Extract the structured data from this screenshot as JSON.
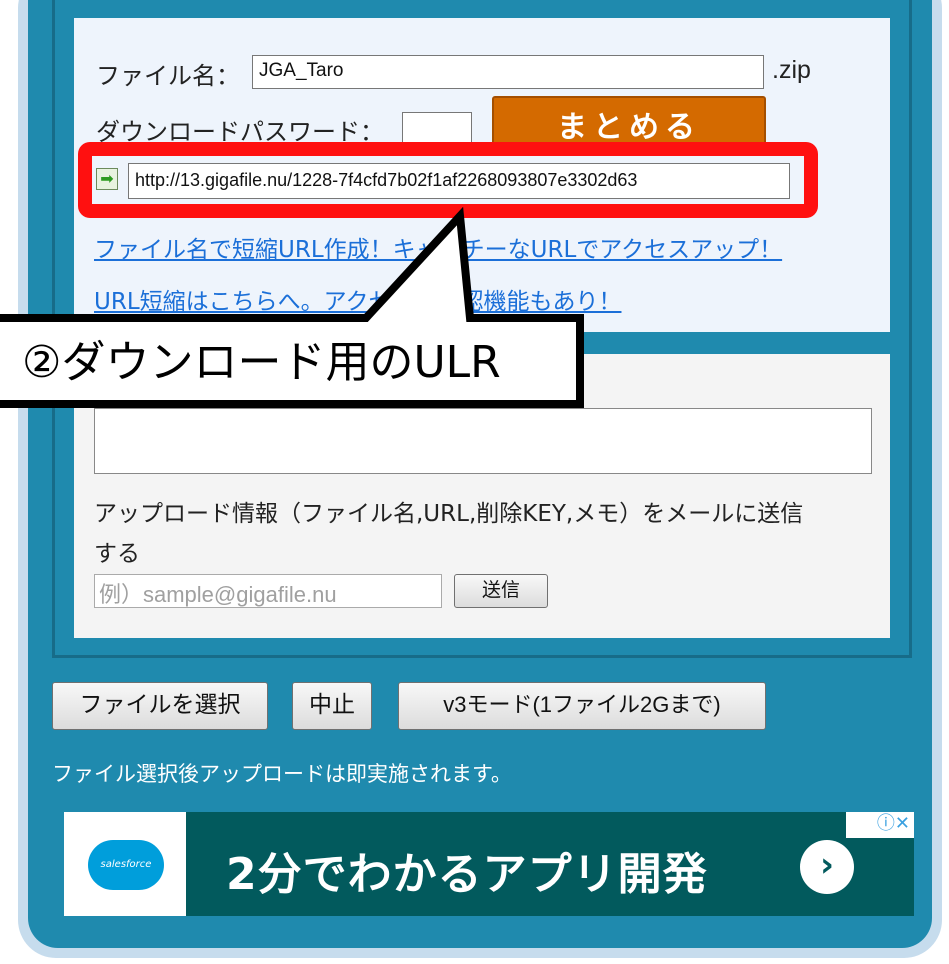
{
  "form": {
    "filename_label": "ファイル名：",
    "filename_value": "JGA_Taro",
    "filename_ext": ".zip",
    "password_label": "ダウンロードパスワード：",
    "password_value": "",
    "combine_button": "まとめる",
    "download_url": "http://13.gigafile.nu/1228-7f4cfd7b02f1af2268093807e3302d63",
    "short_url_link": "ファイル名で短縮URL作成！キャッチーなURLでアクセスアップ！",
    "url_shortener_link": "URL短縮はこちらへ。アクセス数確認機能もあり！"
  },
  "callout": {
    "text": "②ダウンロード用のULR"
  },
  "mail": {
    "memo_value": "",
    "send_info_text_line1": "アップロード情報（ファイル名,URL,削除KEY,メモ）をメールに送信",
    "send_info_text_line2": "する",
    "email_placeholder": "例）sample@gigafile.nu",
    "send_button": "送信"
  },
  "controls": {
    "select_file_button": "ファイルを選択",
    "stop_button": "中止",
    "v3_mode_button": "v3モード(1ファイル2Gまで)",
    "note": "ファイル選択後アップロードは即実施されます。"
  },
  "ad": {
    "logo_text": "salesforce",
    "headline": "2分でわかるアプリ開発",
    "arrow_icon": "chevron-right-icon",
    "info_icons": "ⓘ✕",
    "brand_color": "#025a5d"
  }
}
